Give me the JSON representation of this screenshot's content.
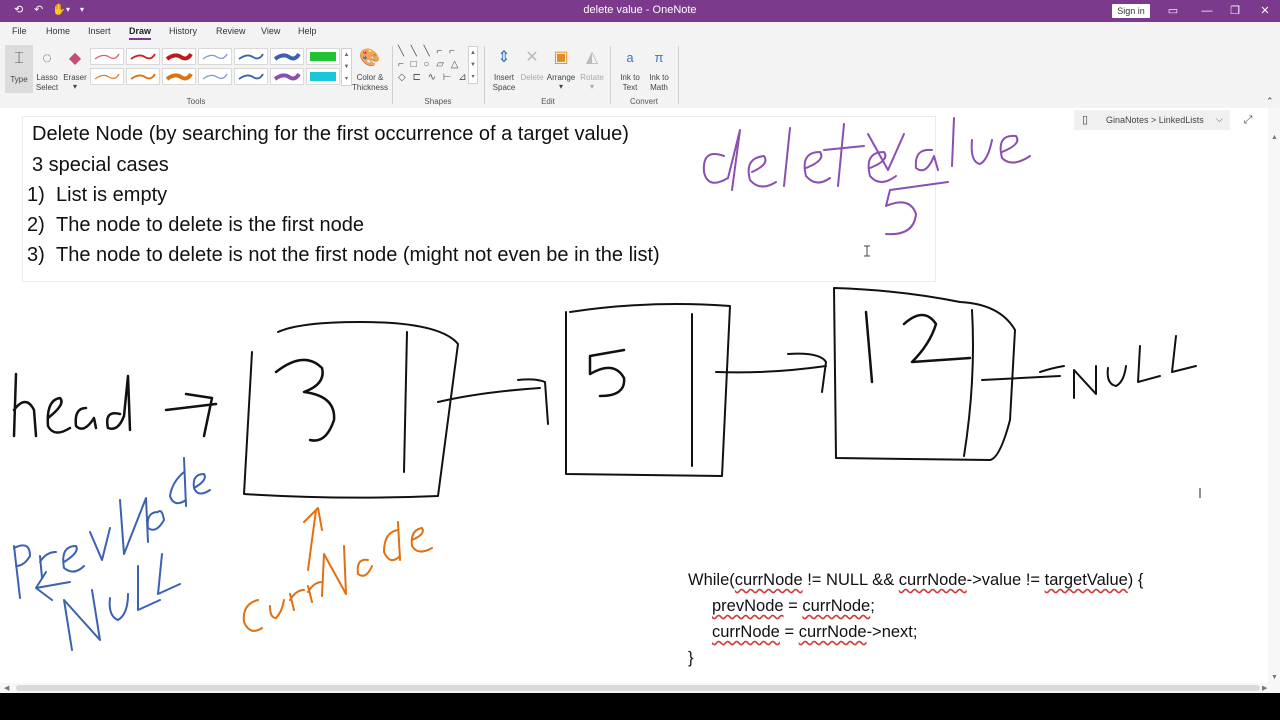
{
  "window": {
    "title": "delete value  -  OneNote",
    "sign_in": "Sign in"
  },
  "menu": {
    "file": "File",
    "home": "Home",
    "insert": "Insert",
    "draw": "Draw",
    "history": "History",
    "review": "Review",
    "view": "View",
    "help": "Help"
  },
  "ribbon": {
    "type": "Type",
    "lasso_1": "Lasso",
    "lasso_2": "Select",
    "eraser": "Eraser",
    "color_1": "Color &",
    "color_2": "Thickness",
    "tools_group": "Tools",
    "shapes_group": "Shapes",
    "insert_1": "Insert",
    "insert_2": "Space",
    "delete": "Delete",
    "arrange": "Arrange",
    "rotate": "Rotate",
    "edit_group": "Edit",
    "ink_text_1": "Ink to",
    "ink_text_2": "Text",
    "ink_math_1": "Ink to",
    "ink_math_2": "Math",
    "convert_group": "Convert"
  },
  "pens": [
    {
      "color": "#e06060"
    },
    {
      "color": "#d02020"
    },
    {
      "color": "#c0181d"
    },
    {
      "color": "#7a9cc8"
    },
    {
      "color": "#3a62b0"
    },
    {
      "color": "#3a62b0"
    },
    {
      "color": "#22c230"
    },
    {
      "color": "#e08030"
    },
    {
      "color": "#e07010"
    },
    {
      "color": "#e07010"
    },
    {
      "color": "#7a9cc8"
    },
    {
      "color": "#3a62b0"
    },
    {
      "color": "#8b4fb0"
    },
    {
      "color": "#18c8d8"
    }
  ],
  "breadcrumb": "GinaNotes > LinkedLists",
  "notes": {
    "line1": "Delete Node (by searching for the first occurrence of a target value)",
    "line2": "3 special cases",
    "l3_num": "1)",
    "l3_text": "List is empty",
    "l4_num": "2)",
    "l4_text": "The node to delete is the first node",
    "l5_num": "3)",
    "l5_text": "The node to delete is not the first node (might not even be in the list)"
  },
  "code": {
    "l1_a": "While(",
    "l1_b": "currNode",
    "l1_c": " != NULL && ",
    "l1_d": "currNode",
    "l1_e": "->value != ",
    "l1_f": "targetValue",
    "l1_g": ") {",
    "l2_a": "prevNode",
    "l2_b": " = ",
    "l2_c": "currNode",
    "l2_d": ";",
    "l3_a": "currNode",
    "l3_b": " = ",
    "l3_c": "currNode",
    "l3_d": "->next;",
    "l4": "}"
  },
  "handwriting": {
    "delete_value": "delete value",
    "five_purple": "5",
    "head": "head",
    "node1": "3",
    "node2": "5",
    "node3": "12",
    "null_right": "NULL",
    "prev_node": "prevNode",
    "null_left": "NULL",
    "curr_node": "currNode"
  },
  "ink_colors": {
    "black": "#111111",
    "purple": "#8b4fb0",
    "blue": "#3a62b0",
    "orange": "#e07010"
  }
}
